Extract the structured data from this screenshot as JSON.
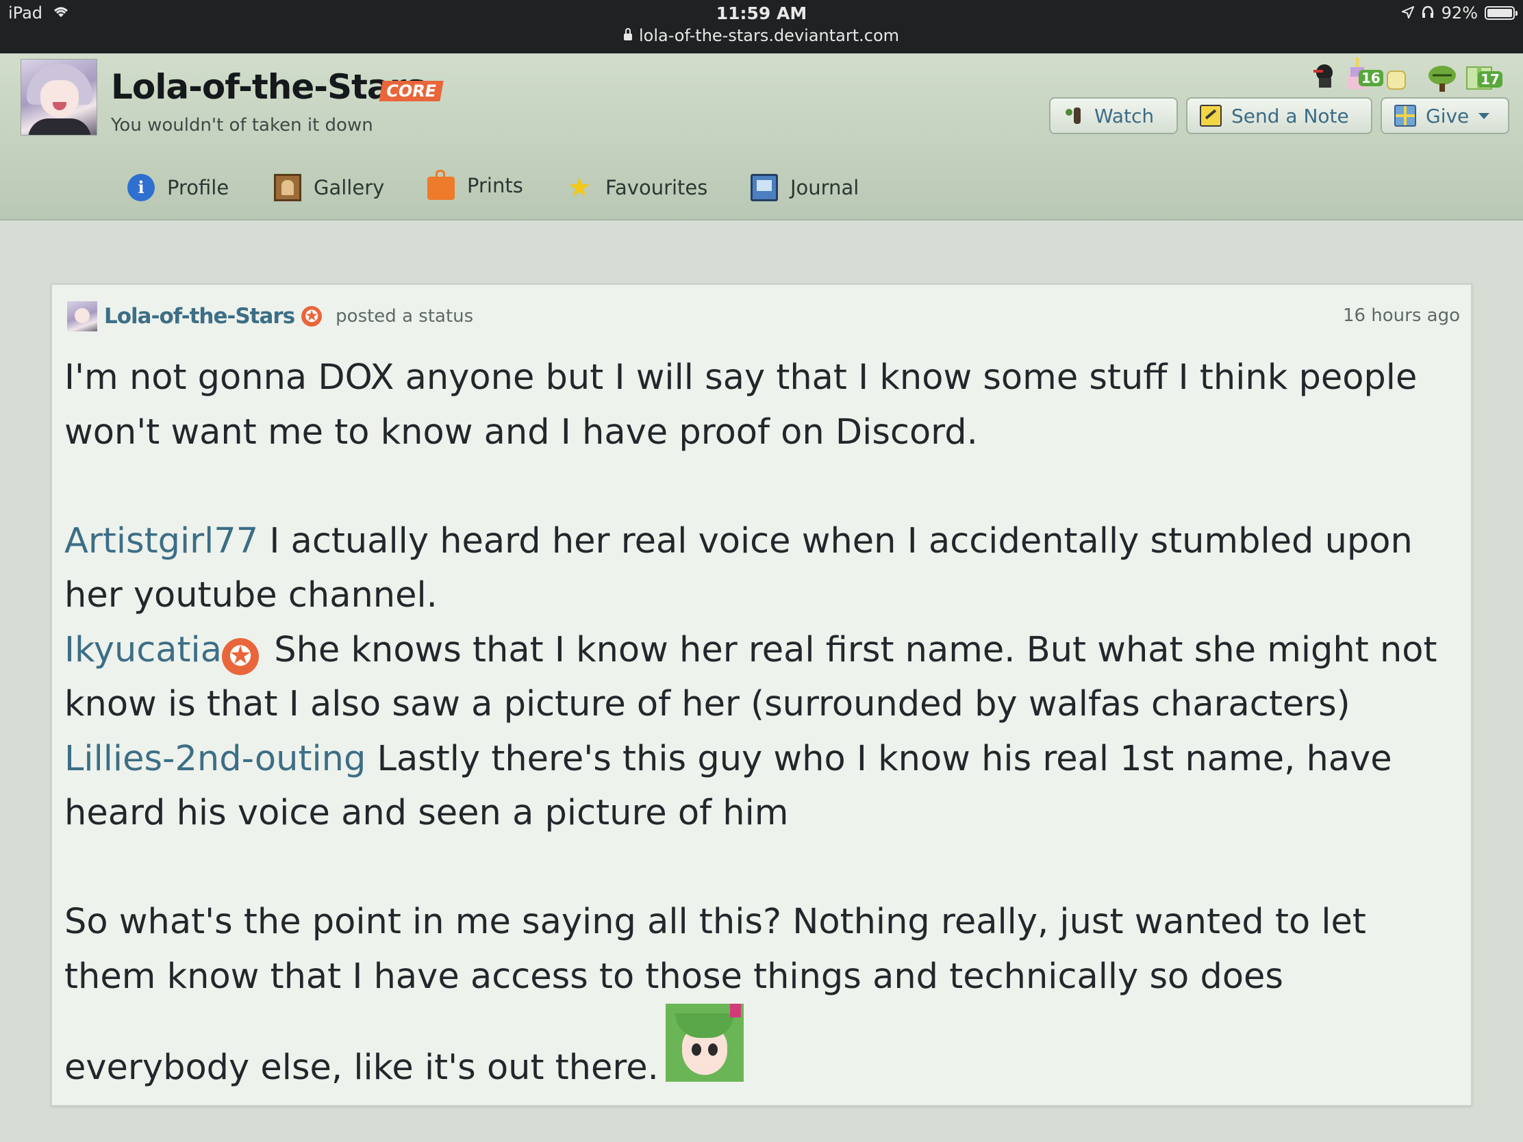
{
  "status_bar": {
    "device": "iPad",
    "time": "11:59 AM",
    "url": "lola-of-the-stars.deviantart.com",
    "battery": "92%"
  },
  "header": {
    "title": "Lola-of-the-Stars",
    "core_label": "CORE",
    "tagline": "You wouldn't of taken it down",
    "buttons": {
      "watch": "Watch",
      "send_note": "Send a Note",
      "give": "Give"
    },
    "badges": {
      "count_a": "16",
      "count_b": "17"
    }
  },
  "nav": {
    "items": [
      {
        "label": "Profile",
        "icon": "info-icon"
      },
      {
        "label": "Gallery",
        "icon": "gallery-icon"
      },
      {
        "label": "Prints",
        "icon": "prints-bag-icon"
      },
      {
        "label": "Favourites",
        "icon": "star-icon"
      },
      {
        "label": "Journal",
        "icon": "journal-icon"
      }
    ]
  },
  "post": {
    "author": "Lola-of-the-Stars",
    "action": "posted a status",
    "time": "16 hours ago",
    "para1": "I'm not gonna DOX anyone but I will say that I know some stuff I think people won't want me to know and I have proof on Discord.",
    "mention1": "Artistgirl77",
    "text1": " I actually heard her real voice when I accidentally stumbled upon her youtube channel.",
    "mention2": "Ikyucatia",
    "text2": " She knows that I know her real first name. But what she might not know is that I also saw a picture of her (surrounded by walfas characters)",
    "mention3": "Lillies-2nd-outing",
    "text3": " Lastly there's this guy who I know his real 1st name, have heard his voice and seen a picture of him",
    "para_last": "So what's the point in me saying all this? Nothing really, just wanted to let them know that I have access to those things and technically so does everybody else, like it's out there."
  },
  "colors": {
    "accent_link": "#3c6e86",
    "core_orange": "#e8663a",
    "header_green": "#c4d2be",
    "page_bg": "#d6ddd4"
  }
}
